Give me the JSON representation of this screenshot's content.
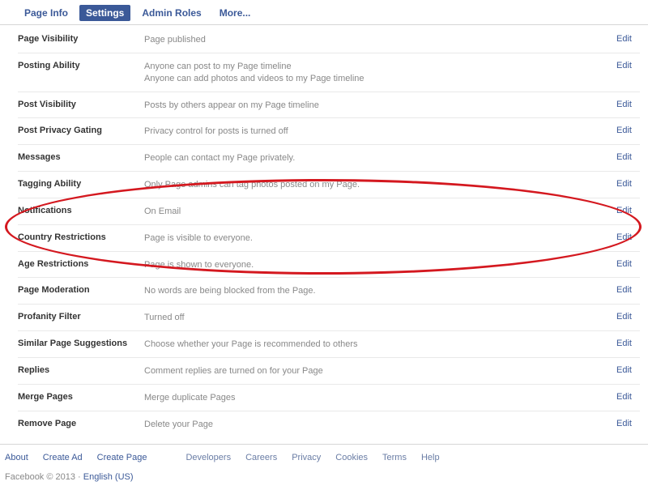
{
  "tabs": {
    "page_info": "Page Info",
    "settings": "Settings",
    "admin_roles": "Admin Roles",
    "more": "More..."
  },
  "rows": {
    "page_visibility": {
      "label": "Page Visibility",
      "value": "Page published",
      "edit": "Edit"
    },
    "posting_ability": {
      "label": "Posting Ability",
      "value1": "Anyone can post to my Page timeline",
      "value2": "Anyone can add photos and videos to my Page timeline",
      "edit": "Edit"
    },
    "post_visibility": {
      "label": "Post Visibility",
      "value": "Posts by others appear on my Page timeline",
      "edit": "Edit"
    },
    "post_privacy": {
      "label": "Post Privacy Gating",
      "value": "Privacy control for posts is turned off",
      "edit": "Edit"
    },
    "messages": {
      "label": "Messages",
      "value": "People can contact my Page privately.",
      "edit": "Edit"
    },
    "tagging": {
      "label": "Tagging Ability",
      "value": "Only Page admins can tag photos posted on my Page.",
      "edit": "Edit"
    },
    "notifications": {
      "label": "Notifications",
      "value": "On Email",
      "edit": "Edit"
    },
    "country": {
      "label": "Country Restrictions",
      "value": "Page is visible to everyone.",
      "edit": "Edit"
    },
    "age": {
      "label": "Age Restrictions",
      "value": "Page is shown to everyone.",
      "edit": "Edit"
    },
    "moderation": {
      "label": "Page Moderation",
      "value": "No words are being blocked from the Page.",
      "edit": "Edit"
    },
    "profanity": {
      "label": "Profanity Filter",
      "value": "Turned off",
      "edit": "Edit"
    },
    "similar": {
      "label": "Similar Page Suggestions",
      "value": "Choose whether your Page is recommended to others",
      "edit": "Edit"
    },
    "replies": {
      "label": "Replies",
      "value": "Comment replies are turned on for your Page",
      "edit": "Edit"
    },
    "merge": {
      "label": "Merge Pages",
      "value": "Merge duplicate Pages",
      "edit": "Edit"
    },
    "remove": {
      "label": "Remove Page",
      "value": "Delete your Page",
      "edit": "Edit"
    }
  },
  "footer": {
    "about": "About",
    "create_ad": "Create Ad",
    "create_page": "Create Page",
    "developers": "Developers",
    "careers": "Careers",
    "privacy": "Privacy",
    "cookies": "Cookies",
    "terms": "Terms",
    "help": "Help",
    "copyright": "Facebook © 2013 · ",
    "lang": "English (US)"
  }
}
